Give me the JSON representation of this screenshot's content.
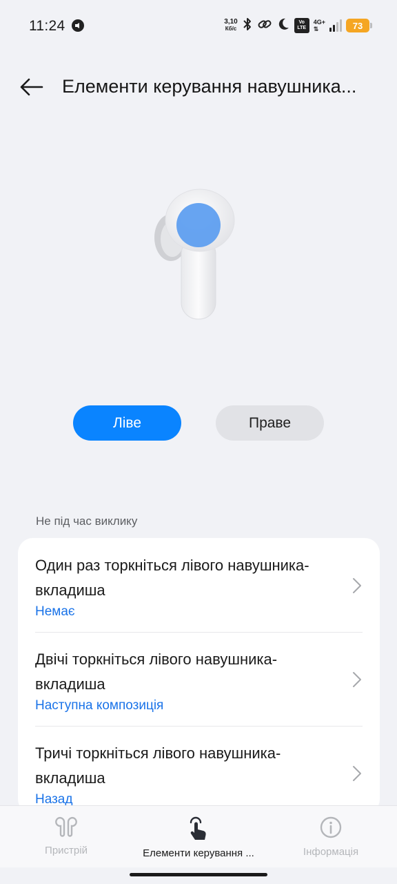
{
  "status_bar": {
    "time": "11:24",
    "net_speed_value": "3,10",
    "net_speed_unit": "Кб/с",
    "volte_top": "Vo",
    "volte_bottom": "LTE",
    "network_type": "4G+",
    "battery_level": "73",
    "battery_color": "#f5a623",
    "icons": [
      "notification-icon",
      "bluetooth-icon",
      "link-icon",
      "moon-icon",
      "volte-icon",
      "signal-icon",
      "battery-icon"
    ]
  },
  "header": {
    "title": "Елементи керування навушника..."
  },
  "side_selector": {
    "left_label": "Ліве",
    "right_label": "Праве",
    "selected": "left",
    "accent_color": "#0a84ff"
  },
  "section": {
    "title": "Не під час виклику",
    "rows": [
      {
        "title": "Один раз торкніться лівого навушника-вкладиша",
        "value": "Немає"
      },
      {
        "title": "Двічі торкніться лівого навушника-вкладиша",
        "value": "Наступна композиція"
      },
      {
        "title": "Тричі торкніться лівого навушника-вкладиша",
        "value": "Назад"
      }
    ]
  },
  "bottom_nav": {
    "tabs": [
      {
        "label": "Пристрій",
        "icon": "earbuds-icon",
        "active": false
      },
      {
        "label": "Елементи керування ...",
        "icon": "touch-icon",
        "active": true
      },
      {
        "label": "Інформація",
        "icon": "info-icon",
        "active": false
      }
    ]
  }
}
